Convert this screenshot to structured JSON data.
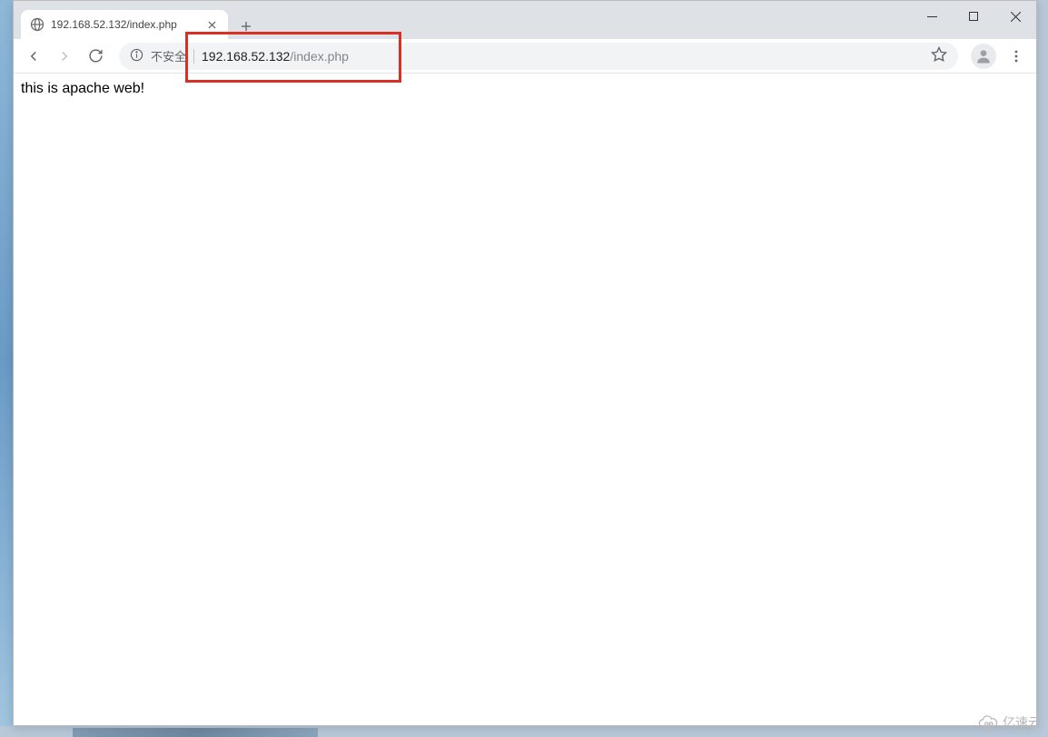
{
  "tab": {
    "title": "192.168.52.132/index.php"
  },
  "toolbar": {
    "security_label": "不安全",
    "url_host": "192.168.52.132",
    "url_path": "/index.php"
  },
  "page": {
    "body_text": "this is apache web!"
  },
  "watermark": {
    "text": "亿速云"
  }
}
